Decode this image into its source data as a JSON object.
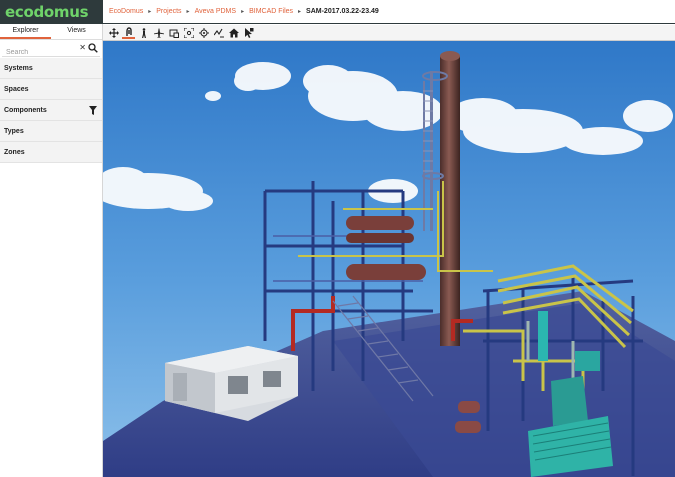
{
  "brand": {
    "logo_text": "ecodomus"
  },
  "breadcrumb": [
    {
      "label": "EcoDomus"
    },
    {
      "label": "Projects"
    },
    {
      "label": "Aveva PDMS"
    },
    {
      "label": "BIMCAD Files"
    },
    {
      "label": "SAM-2017.03.22-23.49"
    }
  ],
  "sidebar": {
    "tabs": [
      {
        "label": "Explorer",
        "active": true
      },
      {
        "label": "Views",
        "active": false
      }
    ],
    "search": {
      "placeholder": "Search",
      "value": ""
    },
    "sections": [
      {
        "label": "Systems"
      },
      {
        "label": "Spaces"
      },
      {
        "label": "Components",
        "icon": "filter-icon"
      },
      {
        "label": "Types"
      },
      {
        "label": "Zones"
      }
    ]
  },
  "toolbar": {
    "tools": [
      {
        "icon": "move-icon"
      },
      {
        "icon": "orbit-icon",
        "active": true
      },
      {
        "icon": "walk-icon"
      },
      {
        "icon": "fly-icon"
      },
      {
        "icon": "section-box-icon"
      },
      {
        "icon": "zoom-extents-icon"
      },
      {
        "icon": "focus-icon"
      },
      {
        "icon": "measure-icon"
      },
      {
        "icon": "home-icon"
      },
      {
        "icon": "select-icon"
      }
    ]
  },
  "colors": {
    "accent": "#e0633c",
    "logo_bg": "#2e3a3c",
    "logo_text": "#6fd36a",
    "sky_top": "#2f78c8",
    "sky_bottom": "#8cc0ea",
    "ground": "#3d4f96"
  }
}
